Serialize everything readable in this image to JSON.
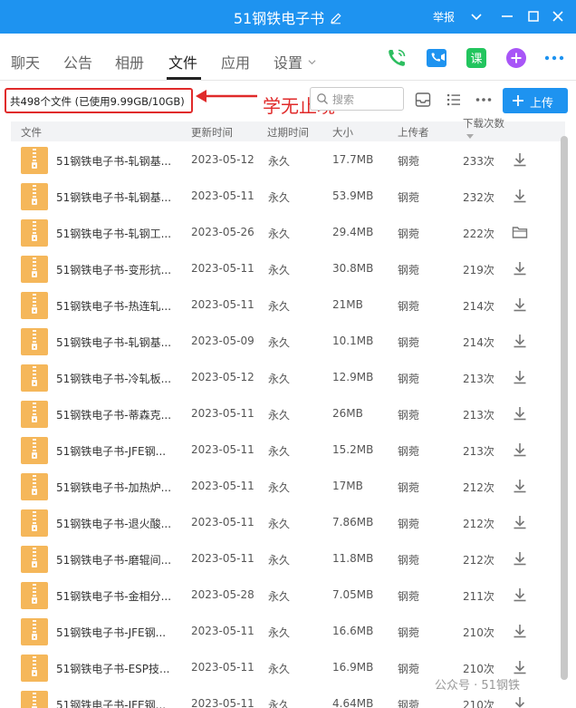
{
  "window": {
    "title": "51钢铁电子书",
    "report_label": "举报"
  },
  "tabs": [
    {
      "label": "聊天"
    },
    {
      "label": "公告"
    },
    {
      "label": "相册"
    },
    {
      "label": "文件",
      "active": true
    },
    {
      "label": "应用"
    },
    {
      "label": "设置"
    }
  ],
  "app_icons": [
    {
      "name": "phone-call-icon",
      "color": "#2dbe60"
    },
    {
      "name": "video-call-icon",
      "color": "#1e93f0"
    },
    {
      "name": "course-icon",
      "label": "课",
      "color": "#22c55e"
    },
    {
      "name": "add-app-icon",
      "color": "#a855f7"
    },
    {
      "name": "more-icon",
      "color": "#1e93f0"
    }
  ],
  "toolbar": {
    "usage_text": "共498个文件 (已使用9.99GB/10GB)",
    "annotation": "学无止境",
    "search_placeholder": "搜索",
    "upload_label": "上传"
  },
  "columns": {
    "file": "文件",
    "updated": "更新时间",
    "expires": "过期时间",
    "size": "大小",
    "uploader": "上传者",
    "downloads": "下载次数"
  },
  "files": [
    {
      "name": "51钢铁电子书-轧钢基...",
      "date": "2023-05-12",
      "expires": "永久",
      "size": "17.7MB",
      "uploader": "钢菀",
      "downloads": "233次",
      "action": "download"
    },
    {
      "name": "51钢铁电子书-轧钢基...",
      "date": "2023-05-11",
      "expires": "永久",
      "size": "53.9MB",
      "uploader": "钢菀",
      "downloads": "232次",
      "action": "download"
    },
    {
      "name": "51钢铁电子书-轧钢工...",
      "date": "2023-05-26",
      "expires": "永久",
      "size": "29.4MB",
      "uploader": "钢菀",
      "downloads": "222次",
      "action": "folder"
    },
    {
      "name": "51钢铁电子书-变形抗...",
      "date": "2023-05-11",
      "expires": "永久",
      "size": "30.8MB",
      "uploader": "钢菀",
      "downloads": "219次",
      "action": "download"
    },
    {
      "name": "51钢铁电子书-热连轧...",
      "date": "2023-05-11",
      "expires": "永久",
      "size": "21MB",
      "uploader": "钢菀",
      "downloads": "214次",
      "action": "download"
    },
    {
      "name": "51钢铁电子书-轧钢基...",
      "date": "2023-05-09",
      "expires": "永久",
      "size": "10.1MB",
      "uploader": "钢菀",
      "downloads": "214次",
      "action": "download"
    },
    {
      "name": "51钢铁电子书-冷轧板...",
      "date": "2023-05-12",
      "expires": "永久",
      "size": "12.9MB",
      "uploader": "钢菀",
      "downloads": "213次",
      "action": "download"
    },
    {
      "name": "51钢铁电子书-蒂森克...",
      "date": "2023-05-11",
      "expires": "永久",
      "size": "26MB",
      "uploader": "钢菀",
      "downloads": "213次",
      "action": "download"
    },
    {
      "name": "51钢铁电子书-JFE钢...",
      "date": "2023-05-11",
      "expires": "永久",
      "size": "15.2MB",
      "uploader": "钢菀",
      "downloads": "213次",
      "action": "download"
    },
    {
      "name": "51钢铁电子书-加热炉...",
      "date": "2023-05-11",
      "expires": "永久",
      "size": "17MB",
      "uploader": "钢菀",
      "downloads": "212次",
      "action": "download"
    },
    {
      "name": "51钢铁电子书-退火酸...",
      "date": "2023-05-11",
      "expires": "永久",
      "size": "7.86MB",
      "uploader": "钢菀",
      "downloads": "212次",
      "action": "download"
    },
    {
      "name": "51钢铁电子书-磨辊间...",
      "date": "2023-05-11",
      "expires": "永久",
      "size": "11.8MB",
      "uploader": "钢菀",
      "downloads": "212次",
      "action": "download"
    },
    {
      "name": "51钢铁电子书-金相分...",
      "date": "2023-05-28",
      "expires": "永久",
      "size": "7.05MB",
      "uploader": "钢菀",
      "downloads": "211次",
      "action": "download"
    },
    {
      "name": "51钢铁电子书-JFE钢...",
      "date": "2023-05-11",
      "expires": "永久",
      "size": "16.6MB",
      "uploader": "钢菀",
      "downloads": "210次",
      "action": "download"
    },
    {
      "name": "51钢铁电子书-ESP技...",
      "date": "2023-05-11",
      "expires": "永久",
      "size": "16.9MB",
      "uploader": "钢菀",
      "downloads": "210次",
      "action": "download"
    },
    {
      "name": "51钢铁电子书-JFE钢...",
      "date": "2023-05-11",
      "expires": "永久",
      "size": "4.64MB",
      "uploader": "钢菀",
      "downloads": "210次",
      "action": "download"
    }
  ],
  "watermark": "公众号 · 51钢铁"
}
